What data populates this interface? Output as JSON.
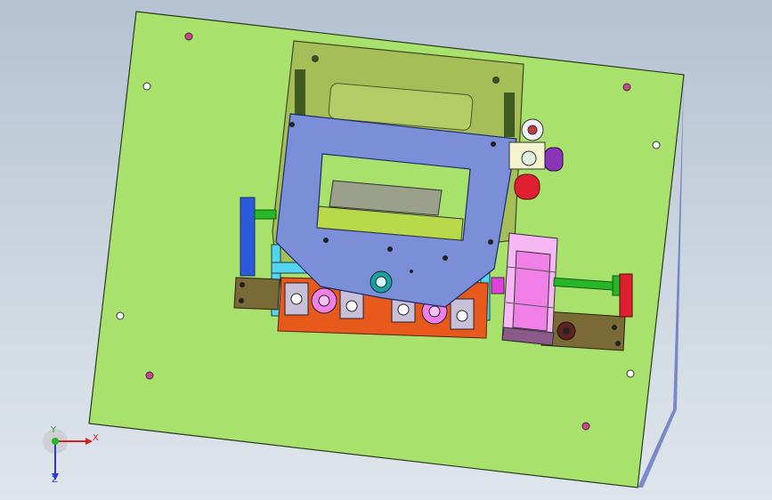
{
  "colors": {
    "base_plate": "#a9e16d",
    "back_plate": "#a6be58",
    "blue_plate": "#7b8ed8",
    "orange_block": "#e8591c",
    "pink_wheel": "#f080e8",
    "cyan_rail": "#55d4f0",
    "green_rod": "#28b528",
    "brown_bar": "#7a6a35",
    "purple_knob": "#8a34b8",
    "red_knob": "#e02030",
    "background_top": "#b4c2d1",
    "background_bottom": "#dfe5ec"
  },
  "triad": {
    "x_label": "X",
    "y_label": "Y",
    "z_label": "Z",
    "icon": "coordinate-triad-icon"
  }
}
